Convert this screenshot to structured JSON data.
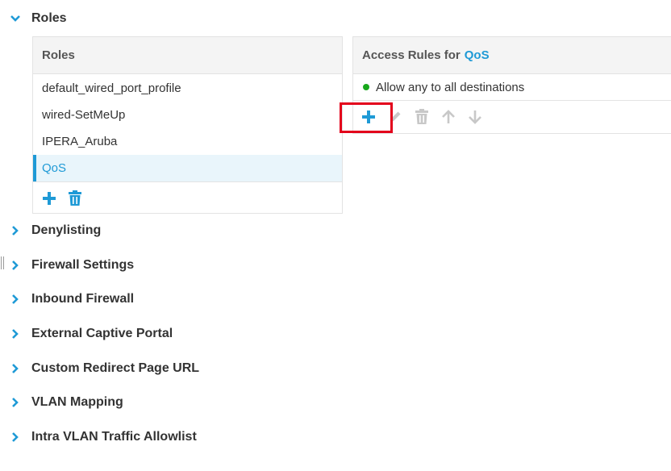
{
  "roles_section": {
    "title": "Roles"
  },
  "roles_panel": {
    "header": "Roles",
    "items": [
      {
        "label": "default_wired_port_profile",
        "selected": false
      },
      {
        "label": "wired-SetMeUp",
        "selected": false
      },
      {
        "label": "IPERA_Aruba",
        "selected": false
      },
      {
        "label": "QoS",
        "selected": true
      }
    ],
    "toolbar_icons": [
      "plus-icon",
      "trash-icon"
    ]
  },
  "access_rules_panel": {
    "header_prefix": "Access Rules for",
    "header_role": "QoS",
    "rules": [
      {
        "label": "Allow any to all destinations",
        "status_color": "#18a81c"
      }
    ],
    "toolbar_icons": [
      "plus-icon",
      "pencil-icon",
      "trash-icon",
      "arrow-up-icon",
      "arrow-down-icon"
    ]
  },
  "sections": [
    {
      "title": "Denylisting"
    },
    {
      "title": "Firewall Settings"
    },
    {
      "title": "Inbound Firewall"
    },
    {
      "title": "External Captive Portal"
    },
    {
      "title": "Custom Redirect Page URL"
    },
    {
      "title": "VLAN Mapping"
    },
    {
      "title": "Intra VLAN Traffic Allowlist"
    }
  ],
  "colors": {
    "accent": "#1f9ad6",
    "highlight": "#e3001b",
    "disabled_icon": "#c8c8c8",
    "status_green": "#18a81c"
  }
}
